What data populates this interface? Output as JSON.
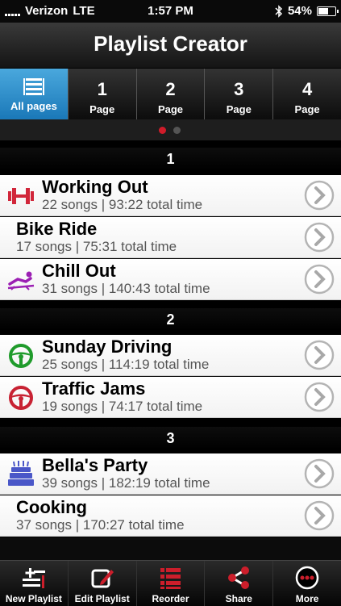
{
  "status": {
    "carrier": "Verizon",
    "network": "LTE",
    "time": "1:57 PM",
    "battery": "54%",
    "battery_level": 0.54
  },
  "nav": {
    "title": "Playlist Creator"
  },
  "pages": {
    "all_label": "All pages",
    "items": [
      {
        "num": "1",
        "label": "Page"
      },
      {
        "num": "2",
        "label": "Page"
      },
      {
        "num": "3",
        "label": "Page"
      },
      {
        "num": "4",
        "label": "Page"
      }
    ]
  },
  "sections": [
    {
      "title": "1",
      "rows": [
        {
          "title": "Working Out",
          "sub": "22 songs | 93:22 total time",
          "icon": "dumbbell-icon"
        },
        {
          "title": "Bike Ride",
          "sub": "17 songs | 75:31 total time",
          "icon": ""
        },
        {
          "title": "Chill Out",
          "sub": "31 songs | 140:43 total time",
          "icon": "lounger-icon"
        }
      ]
    },
    {
      "title": "2",
      "rows": [
        {
          "title": "Sunday Driving",
          "sub": "25 songs | 114:19 total time",
          "icon": "steering-wheel-icon"
        },
        {
          "title": "Traffic Jams",
          "sub": "19 songs | 74:17 total time",
          "icon": "steering-wheel-icon"
        }
      ]
    },
    {
      "title": "3",
      "rows": [
        {
          "title": "Bella's Party",
          "sub": "39 songs | 182:19 total time",
          "icon": "birthday-cake-icon"
        },
        {
          "title": "Cooking",
          "sub": "37 songs | 170:27 total time",
          "icon": ""
        }
      ]
    }
  ],
  "tabs": [
    {
      "label": "New Playlist",
      "icon": "new-playlist-icon"
    },
    {
      "label": "Edit Playlist",
      "icon": "edit-icon"
    },
    {
      "label": "Reorder",
      "icon": "reorder-icon"
    },
    {
      "label": "Share",
      "icon": "share-icon"
    },
    {
      "label": "More",
      "icon": "more-icon"
    }
  ],
  "colors": {
    "accent": "#cc1e2b",
    "selected_tab": "#2a8ccf",
    "dumbbell": "#d1263a",
    "lounger": "#9b1fb3",
    "wheel_green": "#1f9b2b",
    "wheel_red": "#c82233",
    "cake": "#4a57c8"
  }
}
